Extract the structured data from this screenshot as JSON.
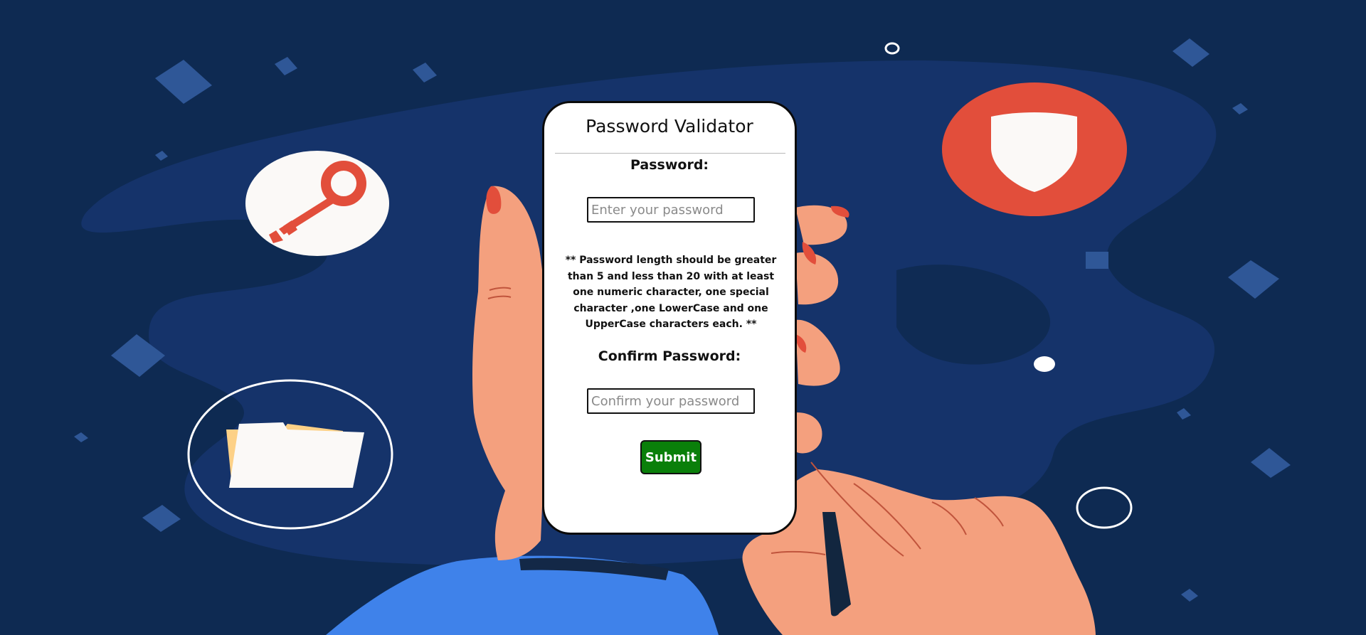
{
  "form": {
    "title": "Password Validator",
    "password_label": "Password:",
    "password_placeholder": "Enter your password",
    "password_value": "",
    "rules_text": "** Password length should be greater than 5 and less than 20 with at least one numeric character, one special character ,one LowerCase and one UpperCase characters each. **",
    "confirm_label": "Confirm Password:",
    "confirm_placeholder": "Confirm your password",
    "confirm_value": "",
    "submit_label": "Submit"
  },
  "illustration": {
    "icons": [
      "key-icon",
      "shield-icon",
      "folder-icon"
    ],
    "colors": {
      "background": "#0e2a52",
      "blob": "#15336a",
      "accent_red": "#e24e3b",
      "skin": "#f4a07e",
      "sleeve": "#3f82ea",
      "submit_green": "#0a7f0a"
    }
  }
}
